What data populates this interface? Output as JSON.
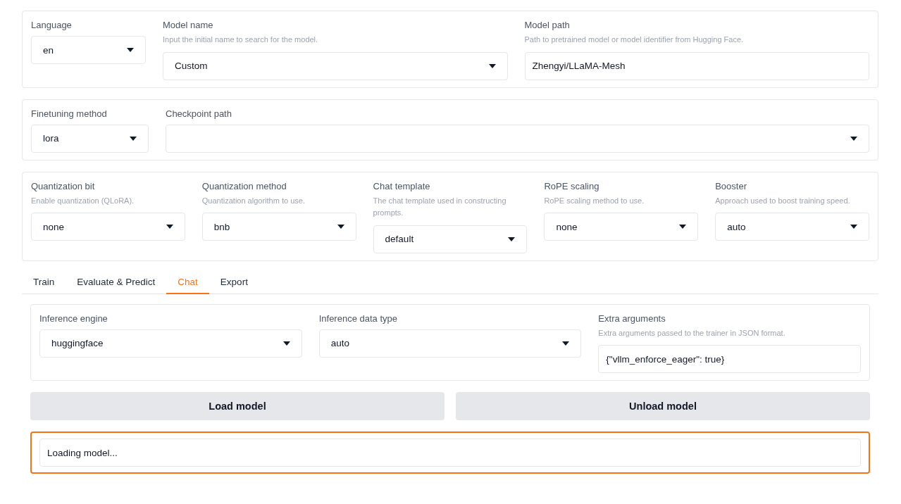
{
  "top_panels": [
    {
      "fields": [
        {
          "kind": "dropdown",
          "label": "Language",
          "value": "en"
        },
        {
          "kind": "dropdown",
          "label": "Model name",
          "hint": "Input the initial name to search for the model.",
          "value": "Custom"
        },
        {
          "kind": "text",
          "label": "Model path",
          "hint": "Path to pretrained model or model identifier from Hugging Face.",
          "value": "Zhengyi/LLaMA-Mesh"
        }
      ]
    },
    {
      "fields": [
        {
          "kind": "dropdown",
          "label": "Finetuning method",
          "value": "lora"
        },
        {
          "kind": "dropdown",
          "label": "Checkpoint path"
        }
      ]
    },
    {
      "fields": [
        {
          "kind": "dropdown",
          "label": "Quantization bit",
          "hint": "Enable quantization (QLoRA).",
          "value": "none"
        },
        {
          "kind": "dropdown",
          "label": "Quantization method",
          "hint": "Quantization algorithm to use.",
          "value": "bnb"
        },
        {
          "kind": "dropdown",
          "label": "Chat template",
          "hint": "The chat template used in constructing prompts.",
          "value": "default"
        },
        {
          "kind": "dropdown",
          "label": "RoPE scaling",
          "hint": "RoPE scaling method to use.",
          "value": "none"
        },
        {
          "kind": "dropdown",
          "label": "Booster",
          "hint": "Approach used to boost training speed.",
          "value": "auto"
        }
      ]
    }
  ],
  "tabs": [
    {
      "label": "Train",
      "selected": false
    },
    {
      "label": "Evaluate & Predict",
      "selected": false
    },
    {
      "label": "Chat",
      "selected": true
    },
    {
      "label": "Export",
      "selected": false
    }
  ],
  "chat_panel": {
    "fields": [
      {
        "kind": "dropdown",
        "label": "Inference engine",
        "value": "huggingface"
      },
      {
        "kind": "dropdown",
        "label": "Inference data type",
        "value": "auto"
      },
      {
        "kind": "text",
        "label": "Extra arguments",
        "hint": "Extra arguments passed to the trainer in JSON format.",
        "value": "{\"vllm_enforce_eager\": true}"
      }
    ]
  },
  "buttons": [
    "Load model",
    "Unload model"
  ],
  "status": {
    "value": "Loading model...",
    "highlighted": true
  }
}
